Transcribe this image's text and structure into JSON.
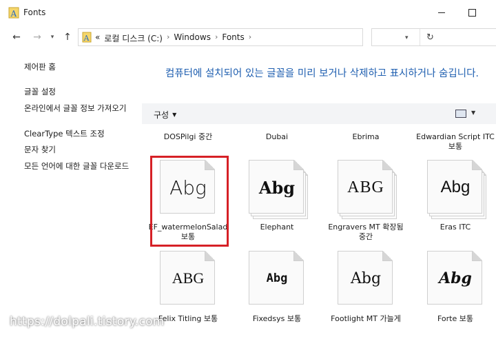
{
  "window": {
    "title": "Fonts"
  },
  "address": {
    "crumbs": [
      "로컬 디스크 (C:)",
      "Windows",
      "Fonts"
    ],
    "overflow": "«"
  },
  "left_pane": {
    "control_panel_home": "제어판 홈",
    "links": [
      "글꼴 설정",
      "온라인에서 글꼴 정보 가져오기",
      "ClearType 텍스트 조정",
      "문자 찾기",
      "모든 언어에 대한 글꼴 다운로드"
    ]
  },
  "main": {
    "heading": "컴퓨터에 설치되어 있는 글꼴을 미리 보거나 삭제하고 표시하거나 숨깁니다.",
    "organize_label": "구성",
    "top_row_labels": [
      "DOSPilgi 중간",
      "Dubai",
      "Ebrima",
      "Edwardian Script ITC 보통"
    ],
    "fonts": [
      {
        "name": "EF_watermelonSalad 보통",
        "sample": "Abg",
        "selected": true
      },
      {
        "name": "Elephant",
        "sample": "Abg",
        "stacked": true
      },
      {
        "name": "Engravers MT 확장됨 중간",
        "sample": "ABG",
        "stacked": true
      },
      {
        "name": "Eras ITC",
        "sample": "Abg",
        "stacked": true
      },
      {
        "name": "Felix Titling 보통",
        "sample": "ABG"
      },
      {
        "name": "Fixedsys 보통",
        "sample": "Abg"
      },
      {
        "name": "Footlight MT 가늘게",
        "sample": "Abg"
      },
      {
        "name": "Forte 보통",
        "sample": "Abg"
      }
    ]
  },
  "watermark": "https://dolpali.tistory.com",
  "colors": {
    "accent": "#1f5fb0",
    "highlight": "#d62026",
    "toolbar": "#f3f4f6"
  }
}
